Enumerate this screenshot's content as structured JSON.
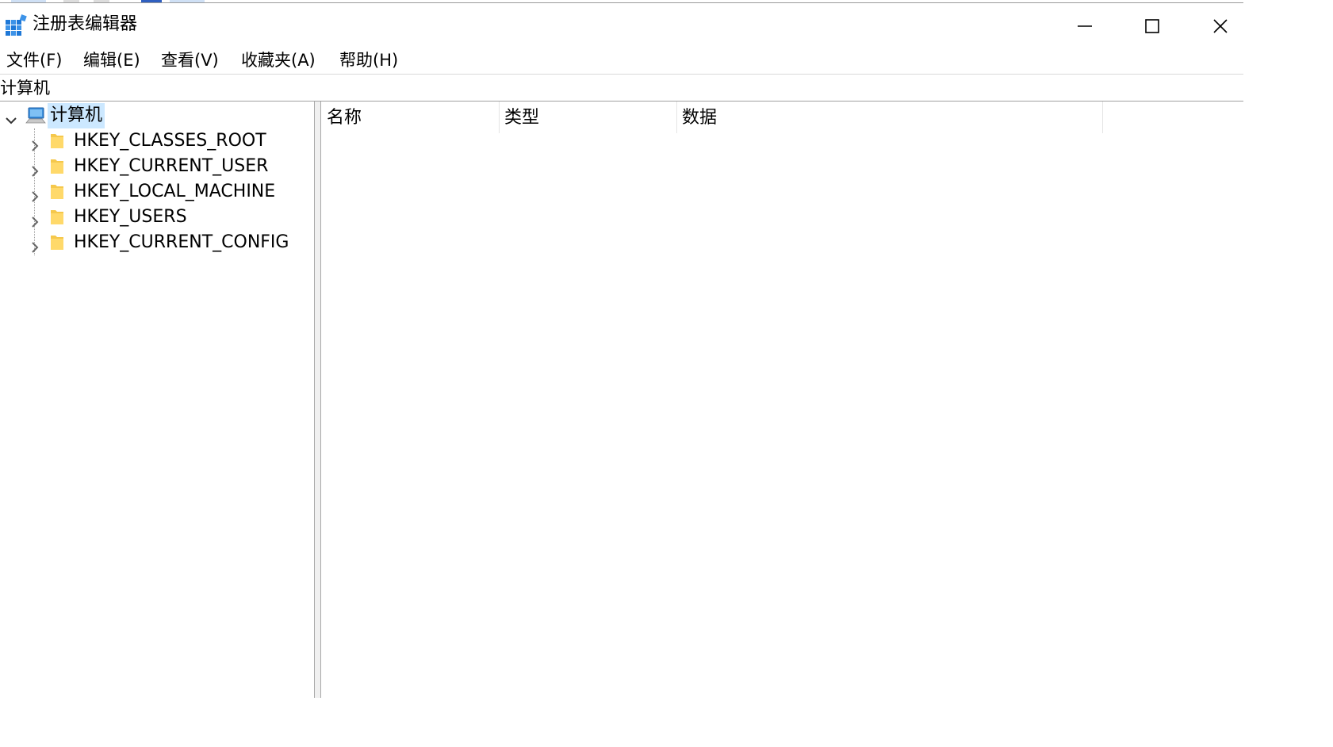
{
  "window": {
    "title": "注册表编辑器",
    "controls": {
      "minimize": "minimize-icon",
      "maximize": "maximize-icon",
      "close": "close-icon"
    }
  },
  "menu": {
    "items": [
      {
        "label": "文件(F)"
      },
      {
        "label": "编辑(E)"
      },
      {
        "label": "查看(V)"
      },
      {
        "label": "收藏夹(A)"
      },
      {
        "label": "帮助(H)"
      }
    ]
  },
  "address": {
    "path": "计算机"
  },
  "tree": {
    "root": {
      "label": "计算机",
      "expanded": true,
      "selected": true
    },
    "children": [
      {
        "label": "HKEY_CLASSES_ROOT"
      },
      {
        "label": "HKEY_CURRENT_USER"
      },
      {
        "label": "HKEY_LOCAL_MACHINE"
      },
      {
        "label": "HKEY_USERS"
      },
      {
        "label": "HKEY_CURRENT_CONFIG"
      }
    ]
  },
  "values": {
    "columns": [
      {
        "label": "名称"
      },
      {
        "label": "类型"
      },
      {
        "label": "数据"
      }
    ]
  },
  "colors": {
    "selection": "#cce8ff",
    "folder": "#f5c84c",
    "app_icon_blue": "#1e78d7"
  }
}
